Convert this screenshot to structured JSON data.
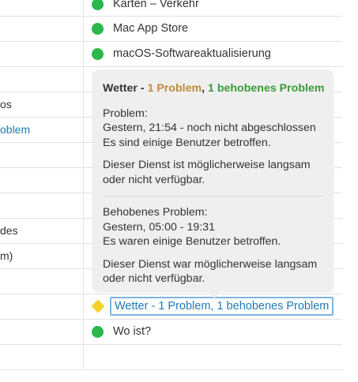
{
  "left_column": [
    {
      "text": "os",
      "link": false
    },
    {
      "text": "oblem",
      "link": true
    },
    {
      "text": "des",
      "link": false
    },
    {
      "text": "m)",
      "link": false
    }
  ],
  "services": [
    {
      "name": "Karten – Verkehr",
      "status": "green"
    },
    {
      "name": "Mac App Store",
      "status": "green"
    },
    {
      "name": "macOS-Softwareaktualisierung",
      "status": "green"
    },
    {
      "name": "Wo ist?",
      "status": "green"
    }
  ],
  "issue_row": {
    "link_text": "Wetter - 1 Problem, 1 behobenes Problem",
    "status": "yellow"
  },
  "popover": {
    "service": "Wetter",
    "sep": " - ",
    "problem_count": "1 Problem",
    "comma": ", ",
    "resolved_count": "1 behobenes Problem",
    "problem_heading": "Problem:",
    "problem_time": "Gestern, 21:54 - noch nicht abgeschlossen",
    "problem_users": "Es sind einige Benutzer betroffen.",
    "problem_desc_1": "Dieser Dienst ist möglicherweise langsam",
    "problem_desc_2": "oder nicht verfügbar.",
    "resolved_heading": "Behobenes Problem:",
    "resolved_time": "Gestern, 05:00 - 19:31",
    "resolved_users": "Es waren einige Benutzer betroffen.",
    "resolved_desc_1": "Dieser Dienst war möglicherweise langsam",
    "resolved_desc_2": "oder nicht verfügbar."
  },
  "colors": {
    "status_green": "#2ab84a",
    "status_yellow": "#f2d22a",
    "link_blue": "#1d7bb8",
    "problem_orange": "#c18a39",
    "resolved_green": "#3a9a3a"
  }
}
